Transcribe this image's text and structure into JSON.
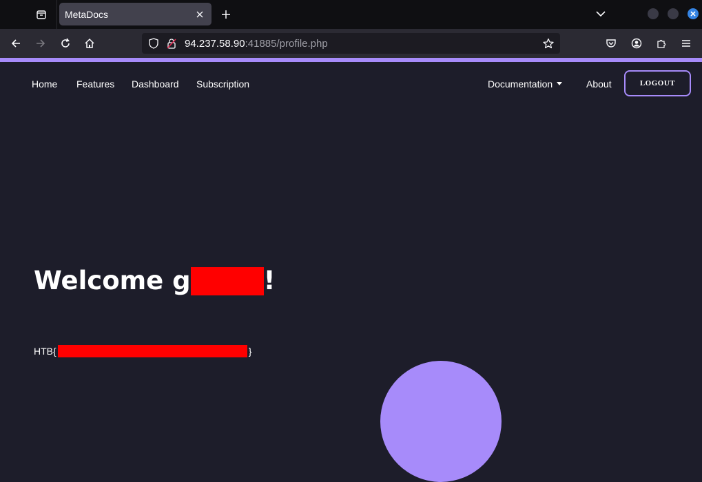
{
  "browser": {
    "tab_title": "MetaDocs",
    "url_host": "94.237.58.90",
    "url_rest": ":41885/profile.php"
  },
  "site_nav": {
    "links": [
      "Home",
      "Features",
      "Dashboard",
      "Subscription"
    ],
    "documentation": "Documentation",
    "about": "About",
    "logout": "LOGOUT"
  },
  "content": {
    "welcome_prefix": "Welcome g",
    "welcome_suffix": "!",
    "flag_prefix": "HTB{",
    "flag_suffix": "}"
  },
  "colors": {
    "accent": "#a78bfa",
    "background": "#1d1d2a",
    "redaction": "#ff0000"
  }
}
